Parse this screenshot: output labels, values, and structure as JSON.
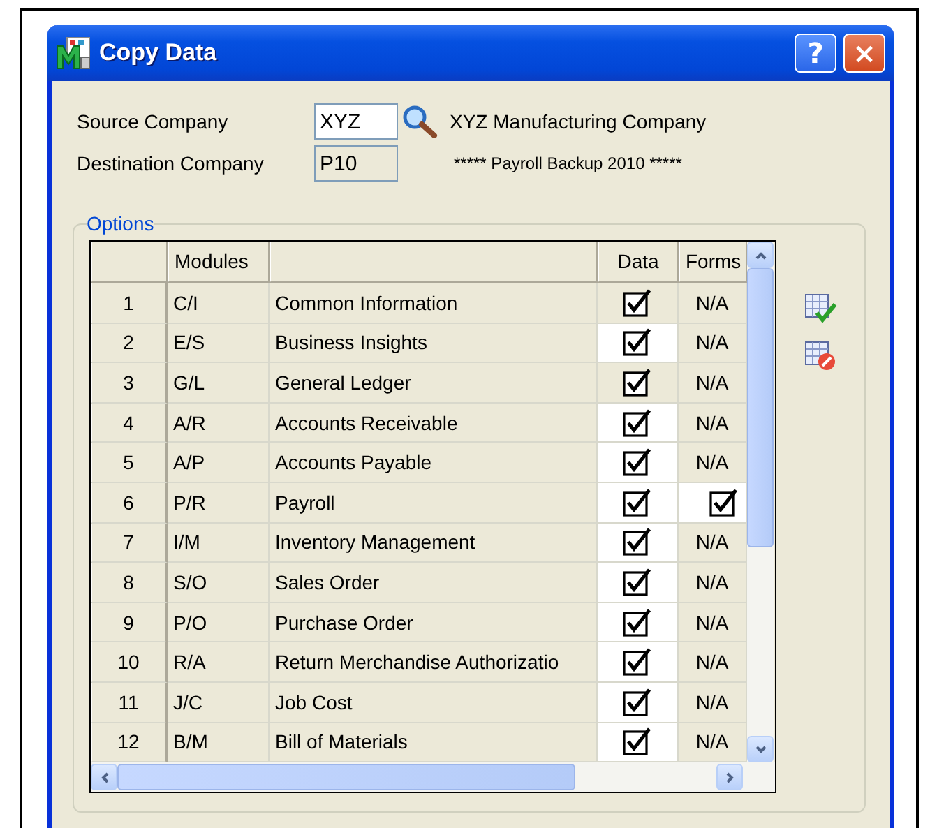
{
  "window": {
    "title": "Copy Data",
    "help_button": "?",
    "close_button": "×"
  },
  "source_company": {
    "label": "Source Company",
    "value": "XYZ",
    "description": "XYZ Manufacturing Company"
  },
  "destination_company": {
    "label": "Destination Company",
    "value": "P10",
    "description": "***** Payroll Backup 2010 *****"
  },
  "options": {
    "title": "Options",
    "columns": [
      "Modules",
      "Data",
      "Forms"
    ],
    "rows": [
      {
        "number": "1",
        "code": "C/I",
        "name": "Common Information",
        "data": {
          "checked": true,
          "editable": false
        },
        "forms": {
          "kind": "text",
          "text": "N/A"
        }
      },
      {
        "number": "2",
        "code": "E/S",
        "name": "Business Insights",
        "data": {
          "checked": true,
          "editable": true
        },
        "forms": {
          "kind": "text",
          "text": "N/A"
        }
      },
      {
        "number": "3",
        "code": "G/L",
        "name": "General Ledger",
        "data": {
          "checked": true,
          "editable": false
        },
        "forms": {
          "kind": "text",
          "text": "N/A"
        }
      },
      {
        "number": "4",
        "code": "A/R",
        "name": "Accounts Receivable",
        "data": {
          "checked": true,
          "editable": true
        },
        "forms": {
          "kind": "text",
          "text": "N/A"
        }
      },
      {
        "number": "5",
        "code": "A/P",
        "name": "Accounts Payable",
        "data": {
          "checked": true,
          "editable": true
        },
        "forms": {
          "kind": "text",
          "text": "N/A"
        }
      },
      {
        "number": "6",
        "code": "P/R",
        "name": "Payroll",
        "data": {
          "checked": true,
          "editable": true
        },
        "forms": {
          "kind": "checkbox",
          "checked": true
        }
      },
      {
        "number": "7",
        "code": "I/M",
        "name": "Inventory Management",
        "data": {
          "checked": true,
          "editable": true
        },
        "forms": {
          "kind": "text",
          "text": "N/A"
        }
      },
      {
        "number": "8",
        "code": "S/O",
        "name": "Sales Order",
        "data": {
          "checked": true,
          "editable": true
        },
        "forms": {
          "kind": "text",
          "text": "N/A"
        }
      },
      {
        "number": "9",
        "code": "P/O",
        "name": "Purchase Order",
        "data": {
          "checked": true,
          "editable": true
        },
        "forms": {
          "kind": "text",
          "text": "N/A"
        }
      },
      {
        "number": "10",
        "code": "R/A",
        "name": "Return Merchandise Authorizatio",
        "data": {
          "checked": true,
          "editable": true
        },
        "forms": {
          "kind": "text",
          "text": "N/A"
        }
      },
      {
        "number": "11",
        "code": "J/C",
        "name": "Job Cost",
        "data": {
          "checked": true,
          "editable": true
        },
        "forms": {
          "kind": "text",
          "text": "N/A"
        }
      },
      {
        "number": "12",
        "code": "B/M",
        "name": "Bill of Materials",
        "data": {
          "checked": true,
          "editable": true
        },
        "forms": {
          "kind": "text",
          "text": "N/A"
        }
      }
    ]
  }
}
